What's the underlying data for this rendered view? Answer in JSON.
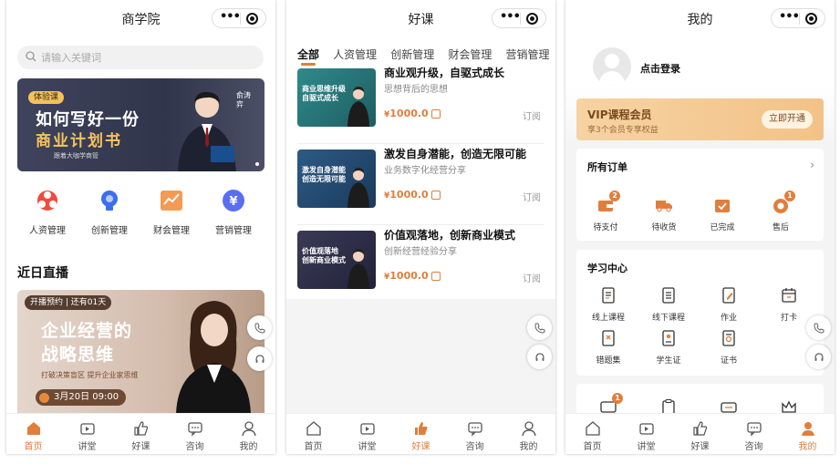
{
  "colors": {
    "accent": "#e07e3c",
    "vip_gold": "#f3c288"
  },
  "screens": [
    {
      "title": "商学院",
      "search_placeholder": "请输入关键词",
      "banner": {
        "tag": "体验课",
        "line1": "如何写好一份",
        "line2": "商业计划书",
        "sub": "跟着大咖学商管",
        "speaker": "俞涛弈"
      },
      "categories": [
        {
          "label": "人资管理",
          "icon": "hr-icon"
        },
        {
          "label": "创新管理",
          "icon": "bulb-icon"
        },
        {
          "label": "财会管理",
          "icon": "finance-icon"
        },
        {
          "label": "营销管理",
          "icon": "yen-icon"
        }
      ],
      "section_title": "近日直播",
      "live": {
        "tag": "开播预约 | 还有01天",
        "title1": "企业经营的",
        "title2": "战略思维",
        "sub": "打破决策盲区 提升企业家思维",
        "date": "3月20日 09:00"
      },
      "active_tab": 0
    },
    {
      "title": "好课",
      "category_tabs": [
        "全部",
        "人资管理",
        "创新管理",
        "财会管理",
        "营销管理"
      ],
      "courses": [
        {
          "title": "商业观升级，自驱式成长",
          "sub": "思想背后的思想",
          "price": "1000.0",
          "currency": "¥",
          "action": "订阅",
          "thumb": "商业思维升级 自驱式成长"
        },
        {
          "title": "激发自身潜能，创造无限可能",
          "sub": "业务数字化经营分享",
          "price": "1000.0",
          "currency": "¥",
          "action": "订阅",
          "thumb": "激发自身潜能 创造无限可能"
        },
        {
          "title": "价值观落地，创新商业模式",
          "sub": "创新经营经验分享",
          "price": "1000.0",
          "currency": "¥",
          "action": "订阅",
          "thumb": "价值观落地 创新商业模式"
        }
      ],
      "active_tab": 2
    },
    {
      "title": "我的",
      "login_label": "点击登录",
      "vip": {
        "title": "VIP课程会员",
        "sub": "享3个会员专享权益",
        "button": "立即开通"
      },
      "orders": {
        "title": "所有订单",
        "items": [
          {
            "label": "待支付",
            "badge": "2",
            "icon": "wallet-icon"
          },
          {
            "label": "待收货",
            "badge": "",
            "icon": "truck-icon"
          },
          {
            "label": "已完成",
            "badge": "",
            "icon": "box-check-icon"
          },
          {
            "label": "售后",
            "badge": "1",
            "icon": "after-sale-icon"
          }
        ]
      },
      "study": {
        "title": "学习中心",
        "items": [
          {
            "label": "线上课程",
            "icon": "online-course-icon"
          },
          {
            "label": "线下课程",
            "icon": "offline-course-icon"
          },
          {
            "label": "作业",
            "icon": "homework-icon"
          },
          {
            "label": "打卡",
            "icon": "calendar-icon"
          },
          {
            "label": "错题集",
            "icon": "mistake-book-icon"
          },
          {
            "label": "学生证",
            "icon": "student-card-icon"
          },
          {
            "label": "证书",
            "icon": "certificate-icon"
          }
        ]
      },
      "more_badge": "1",
      "active_tab": 4
    }
  ],
  "tabbar": [
    "首页",
    "讲堂",
    "好课",
    "咨询",
    "我的"
  ]
}
